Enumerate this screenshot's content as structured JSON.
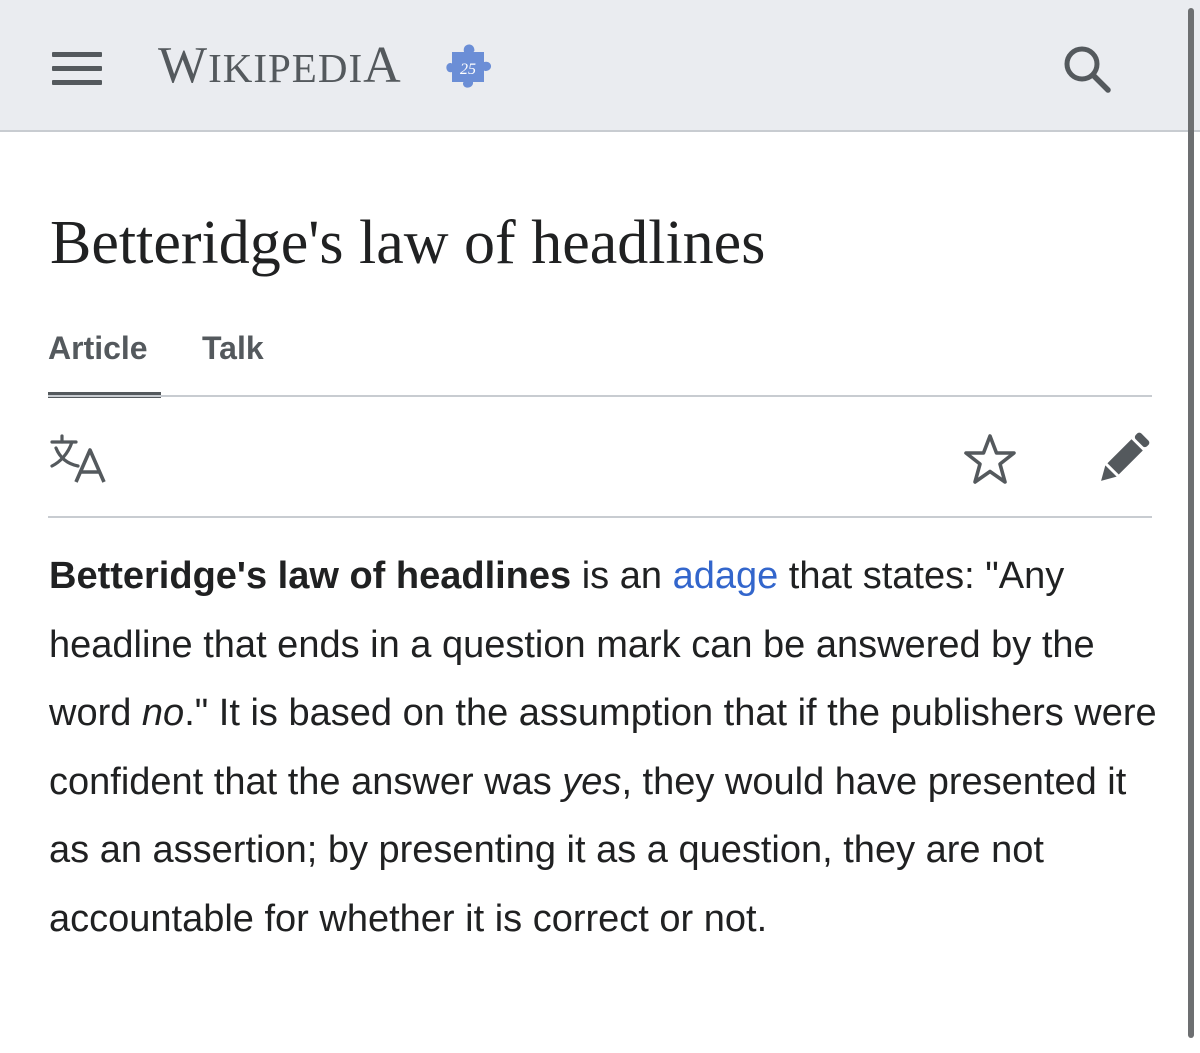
{
  "header": {
    "logo_main": "Wikipedia",
    "anniversary_badge": "25",
    "menu_icon": "hamburger-menu-icon",
    "search_icon": "search-icon"
  },
  "article": {
    "title": "Betteridge's law of headlines",
    "tabs": [
      {
        "label": "Article",
        "selected": true
      },
      {
        "label": "Talk",
        "selected": false
      }
    ],
    "actions": {
      "language_icon": "language-icon",
      "watch_icon": "star-icon",
      "edit_icon": "pencil-icon"
    },
    "paragraph": {
      "bold_term": "Betteridge's law of headlines",
      "text_1": " is an ",
      "link_adage": "adage",
      "text_2": " that states: \"Any headline that ends in a question mark can be answered by the word ",
      "italic_no": "no",
      "text_3": ".\" It is based on the assumption that if the publishers were confident that the answer was ",
      "italic_yes": "yes",
      "text_4": ", they would have presented it as an assertion; by presenting it as a question, they are not accountable for whether it is correct or not."
    }
  },
  "colors": {
    "header_bg": "#eaecf0",
    "text": "#202122",
    "icon_gray": "#54595d",
    "link": "#3366cc",
    "divider": "#c8ccd1"
  }
}
